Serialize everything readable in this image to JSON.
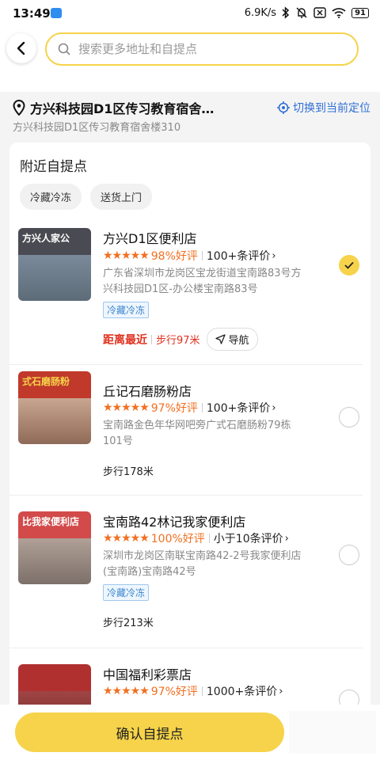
{
  "status_bar": {
    "time": "13:49",
    "speed": "6.9K/s",
    "battery": "91",
    "icons": [
      "app-icon",
      "bluetooth-icon",
      "mute-icon",
      "close-box-icon",
      "wifi-icon",
      "battery-icon"
    ]
  },
  "search": {
    "placeholder": "搜索更多地址和自提点"
  },
  "address": {
    "title": "方兴科技园D1区传习教育宿舍…",
    "detail": "方兴科技园D1区传习教育宿舍楼310",
    "switch_label": "切换到当前定位"
  },
  "nearby": {
    "title": "附近自提点",
    "filters": [
      "冷藏冷冻",
      "送货上门"
    ],
    "stores": [
      {
        "name": "方兴D1区便利店",
        "stars": "★★★★★",
        "score": "98%好评",
        "reviews": "100+条评价",
        "address": "广东省深圳市龙岗区宝龙街道宝南路83号方兴科技园D1区-办公楼宝南路83号",
        "tag": "冷藏冷冻",
        "nearest_label": "距离最近",
        "distance": "步行97米",
        "nav_label": "导航",
        "selected": true,
        "sign_text": "方兴人家公",
        "sign_color": "#4a4a52",
        "wall_color": "#6b7d90"
      },
      {
        "name": "丘记石磨肠粉店",
        "stars": "★★★★★",
        "score": "97%好评",
        "reviews": "100+条评价",
        "address": "宝南路金色年华网吧旁广式石磨肠粉79栋101号",
        "tag": "",
        "distance": "步行178米",
        "selected": false,
        "sign_text": "式石磨肠粉",
        "sign_color": "#c0392b",
        "wall_color": "#b48e78"
      },
      {
        "name": "宝南路42林记我家便利店",
        "stars": "★★★★★",
        "score": "100%好评",
        "reviews": "小于10条评价",
        "address": "深圳市龙岗区南联宝南路42-2号我家便利店(宝南路)宝南路42号",
        "tag": "冷藏冷冻",
        "distance": "步行213米",
        "selected": false,
        "sign_text": "比我家便利店",
        "sign_color": "#d24a4a",
        "wall_color": "#9a8c84"
      },
      {
        "name": "中国福利彩票店",
        "stars": "★★★★★",
        "score": "97%好评",
        "reviews": "1000+条评价",
        "address": "",
        "tag": "",
        "distance": "",
        "selected": false,
        "sign_text": "",
        "sign_color": "#b03030",
        "wall_color": "#8c3b3b"
      }
    ]
  },
  "confirm_label": "确认自提点"
}
